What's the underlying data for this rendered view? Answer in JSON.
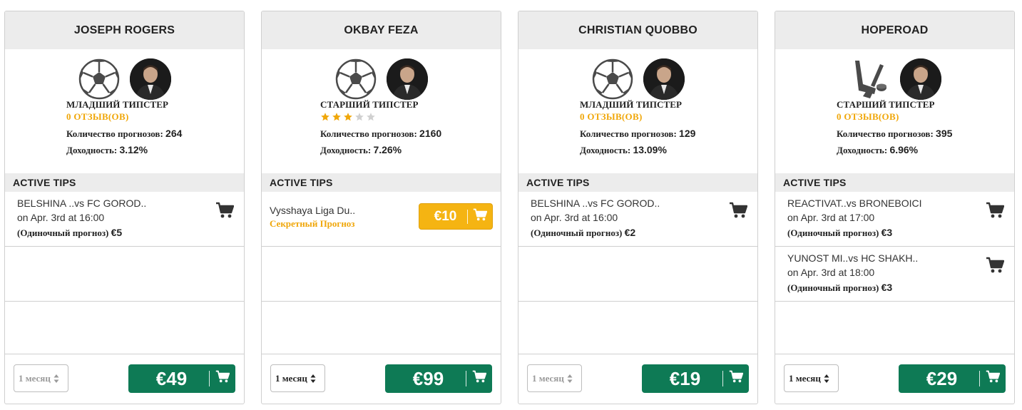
{
  "section": {
    "active_tips_label": "ACTIVE TIPS",
    "currency_symbol": "€"
  },
  "colors": {
    "accent_green": "#0e7a55",
    "accent_gold": "#f5b412",
    "reviews_orange": "#f0a70a",
    "header_bg": "#ececec"
  },
  "cards": [
    {
      "name": "JOSEPH ROGERS",
      "sport_icon": "soccer-ball-icon",
      "level": "МЛАДШИЙ ТИПСТЕР",
      "reviews": "0 ОТЗЫВ(ОВ)",
      "forecasts_label": "Количество прогнозов:",
      "forecasts_value": "264",
      "yield_label": "Доходность:",
      "yield_value": "3.12%",
      "tips": [
        {
          "title": "BELSHINA ..vs FC GOROD..",
          "date": "on Apr. 3rd at 16:00",
          "type": "(Одиночный прогноз)",
          "price": "€5"
        }
      ],
      "period": "1 месяц",
      "period_muted": true,
      "price": "€49"
    },
    {
      "name": "OKBAY FEZA",
      "sport_icon": "soccer-ball-icon",
      "level": "СТАРШИЙ ТИПСТЕР",
      "rating": 3,
      "rating_max": 5,
      "forecasts_label": "Количество прогнозов:",
      "forecasts_value": "2160",
      "yield_label": "Доходность:",
      "yield_value": "7.26%",
      "secret_tip": {
        "title": "Vysshaya Liga Du..",
        "label": "Секретный Прогноз",
        "price": "€10"
      },
      "period": "1 месяц",
      "period_muted": false,
      "price": "€99"
    },
    {
      "name": "CHRISTIAN QUOBBO",
      "sport_icon": "soccer-ball-icon",
      "level": "МЛАДШИЙ ТИПСТЕР",
      "reviews": "0 ОТЗЫВ(ОВ)",
      "forecasts_label": "Количество прогнозов:",
      "forecasts_value": "129",
      "yield_label": "Доходность:",
      "yield_value": "13.09%",
      "tips": [
        {
          "title": "BELSHINA ..vs FC GOROD..",
          "date": "on Apr. 3rd at 16:00",
          "type": "(Одиночный прогноз)",
          "price": "€2"
        }
      ],
      "period": "1 месяц",
      "period_muted": true,
      "price": "€19"
    },
    {
      "name": "HOPEROAD",
      "sport_icon": "hockey-sticks-icon",
      "level": "СТАРШИЙ ТИПСТЕР",
      "reviews": "0 ОТЗЫВ(ОВ)",
      "forecasts_label": "Количество прогнозов:",
      "forecasts_value": "395",
      "yield_label": "Доходность:",
      "yield_value": "6.96%",
      "tips": [
        {
          "title": "REACTIVAT..vs BRONEBOICI",
          "date": "on Apr. 3rd at 17:00",
          "type": "(Одиночный прогноз)",
          "price": "€3"
        },
        {
          "title": "YUNOST MI..vs HC SHAKH..",
          "date": "on Apr. 3rd at 18:00",
          "type": "(Одиночный прогноз)",
          "price": "€3"
        }
      ],
      "period": "1 месяц",
      "period_muted": false,
      "price": "€29"
    }
  ]
}
